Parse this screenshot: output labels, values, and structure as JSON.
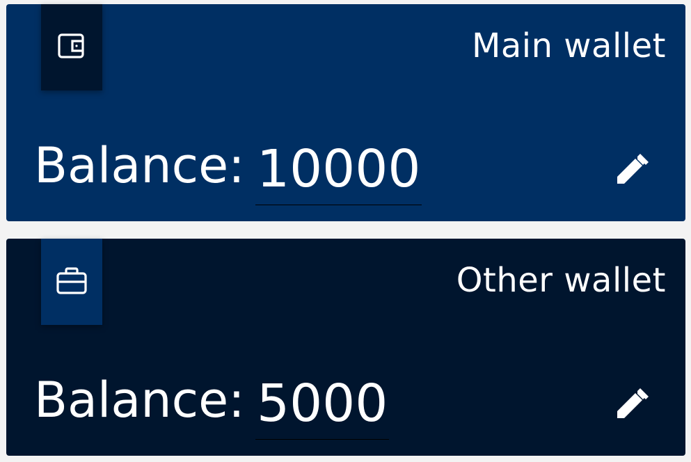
{
  "wallets": [
    {
      "name": "Main wallet",
      "icon": "wallet-icon",
      "balance_label": "Balance:",
      "balance_value": "10000",
      "edit_icon": "pencil-icon",
      "background": "#002f63",
      "tab_background": "#00152e"
    },
    {
      "name": "Other wallet",
      "icon": "briefcase-icon",
      "balance_label": "Balance:",
      "balance_value": "5000",
      "edit_icon": "pencil-icon",
      "background": "#00152e",
      "tab_background": "#002f63"
    }
  ],
  "colors": {
    "text": "#ffffff",
    "page_background": "#f3f3f3"
  }
}
